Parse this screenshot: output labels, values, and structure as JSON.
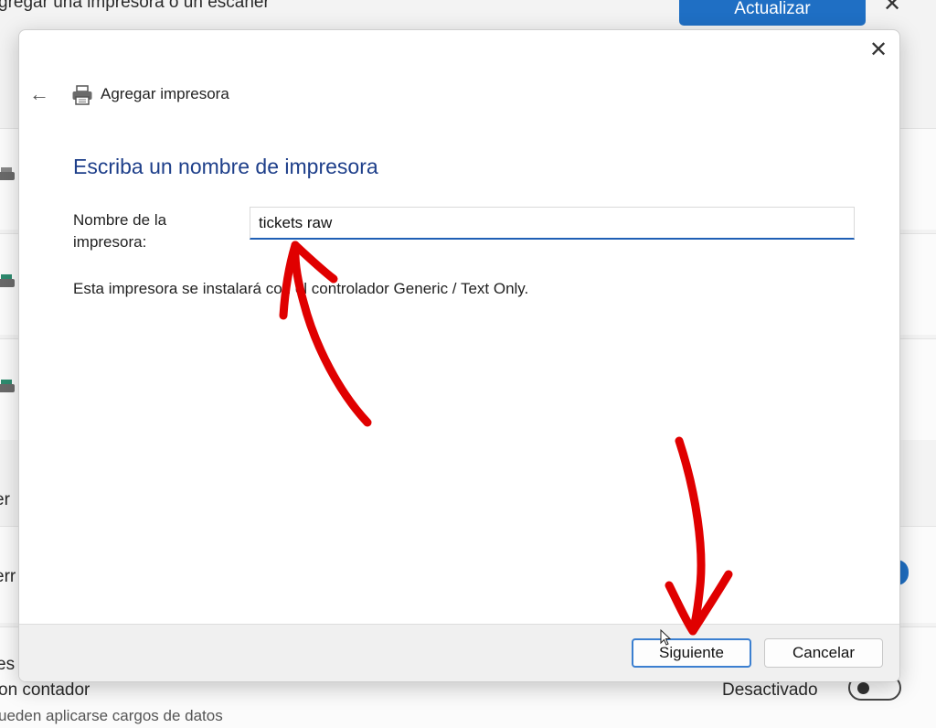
{
  "background": {
    "title": "gregar una impresora o un escáner",
    "update_button": "Actualizar",
    "close_glyph": "✕",
    "row_label_1": "er",
    "row_label_2": "err",
    "row_label_3": "es",
    "metered_label": "on contador",
    "metered_sub": "ueden aplicarse cargos de datos",
    "metered_state": "Desactivado",
    "accent_color": "#1f6fc4"
  },
  "dialog": {
    "close_glyph": "✕",
    "back_glyph": "←",
    "header_title": "Agregar impresora",
    "heading": "Escriba un nombre de impresora",
    "name_label": "Nombre de la impresora:",
    "name_value": "tickets raw",
    "driver_text": "Esta impresora se instalará con el controlador Generic / Text Only.",
    "next_button": "Siguiente",
    "cancel_button": "Cancelar",
    "heading_color": "#1e3f8a",
    "annotation_color": "#e00000"
  },
  "icons": {
    "back": "arrow-left-icon",
    "printer": "printer-icon",
    "close": "close-icon",
    "cursor": "mouse-cursor-icon",
    "annotation_arrows": "red-arrow-icon"
  }
}
